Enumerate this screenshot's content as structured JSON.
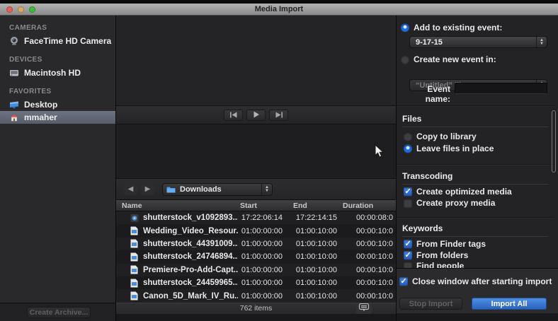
{
  "window": {
    "title": "Media Import"
  },
  "sidebar": {
    "sections": [
      {
        "label": "CAMERAS",
        "items": [
          {
            "label": "FaceTime HD Camera",
            "icon": "camera-icon",
            "selected": false
          }
        ]
      },
      {
        "label": "DEVICES",
        "items": [
          {
            "label": "Macintosh HD",
            "icon": "harddrive-icon",
            "selected": false
          }
        ]
      },
      {
        "label": "FAVORITES",
        "items": [
          {
            "label": "Desktop",
            "icon": "desktop-icon",
            "selected": false
          },
          {
            "label": "mmaher",
            "icon": "home-icon",
            "selected": true
          }
        ]
      }
    ],
    "create_archive_label": "Create Archive..."
  },
  "browser": {
    "location": "Downloads",
    "columns": [
      "Name",
      "Start",
      "End",
      "Duration"
    ],
    "rows": [
      {
        "icon": "movie-file-icon",
        "name": "shutterstock_v1092893...",
        "start": "17:22:06:14",
        "end": "17:22:14:15",
        "duration": "00:00:08:0"
      },
      {
        "icon": "document-file-icon",
        "name": "Wedding_Video_Resour...",
        "start": "01:00:00:00",
        "end": "01:00:10:00",
        "duration": "00:00:10:0"
      },
      {
        "icon": "document-file-icon",
        "name": "shutterstock_44391009...",
        "start": "01:00:00:00",
        "end": "01:00:10:00",
        "duration": "00:00:10:0"
      },
      {
        "icon": "document-file-icon",
        "name": "shutterstock_24746894...",
        "start": "01:00:00:00",
        "end": "01:00:10:00",
        "duration": "00:00:10:0"
      },
      {
        "icon": "document-file-icon",
        "name": "Premiere-Pro-Add-Capt...",
        "start": "01:00:00:00",
        "end": "01:00:10:00",
        "duration": "00:00:10:0"
      },
      {
        "icon": "document-file-icon",
        "name": "shutterstock_24459965...",
        "start": "01:00:00:00",
        "end": "01:00:10:00",
        "duration": "00:00:10:0"
      },
      {
        "icon": "document-file-icon",
        "name": "Canon_5D_Mark_IV_Ru...",
        "start": "01:00:00:00",
        "end": "01:00:10:00",
        "duration": "00:00:10:0"
      }
    ],
    "status": "762 items"
  },
  "import_panel": {
    "add_to_existing": {
      "label": "Add to existing event:",
      "selected": true,
      "value": "9-17-15"
    },
    "create_new": {
      "label": "Create new event in:",
      "selected": false,
      "value": "“Untitled” library"
    },
    "event_name_label": "Event name:",
    "event_name_value": "",
    "files": {
      "title": "Files",
      "options": [
        {
          "label": "Copy to library",
          "type": "radio",
          "checked": false
        },
        {
          "label": "Leave files in place",
          "type": "radio",
          "checked": true
        }
      ]
    },
    "transcoding": {
      "title": "Transcoding",
      "options": [
        {
          "label": "Create optimized media",
          "type": "checkbox",
          "checked": true
        },
        {
          "label": "Create proxy media",
          "type": "checkbox",
          "checked": false
        }
      ]
    },
    "keywords": {
      "title": "Keywords",
      "options": [
        {
          "label": "From Finder tags",
          "type": "checkbox",
          "checked": true
        },
        {
          "label": "From folders",
          "type": "checkbox",
          "checked": true
        },
        {
          "label": "Find people",
          "type": "checkbox",
          "checked": false
        }
      ]
    },
    "close_window_label": "Close window after starting import",
    "close_window_checked": true,
    "stop_label": "Stop Import",
    "import_all_label": "Import All"
  },
  "colors": {
    "accent_blue": "#1f6fe0",
    "import_button_blue": "#3a78d0",
    "selection_gray": "#636b78",
    "titlebar_gray": "#9e9e9e",
    "folder_blue": "#4a9be8"
  }
}
